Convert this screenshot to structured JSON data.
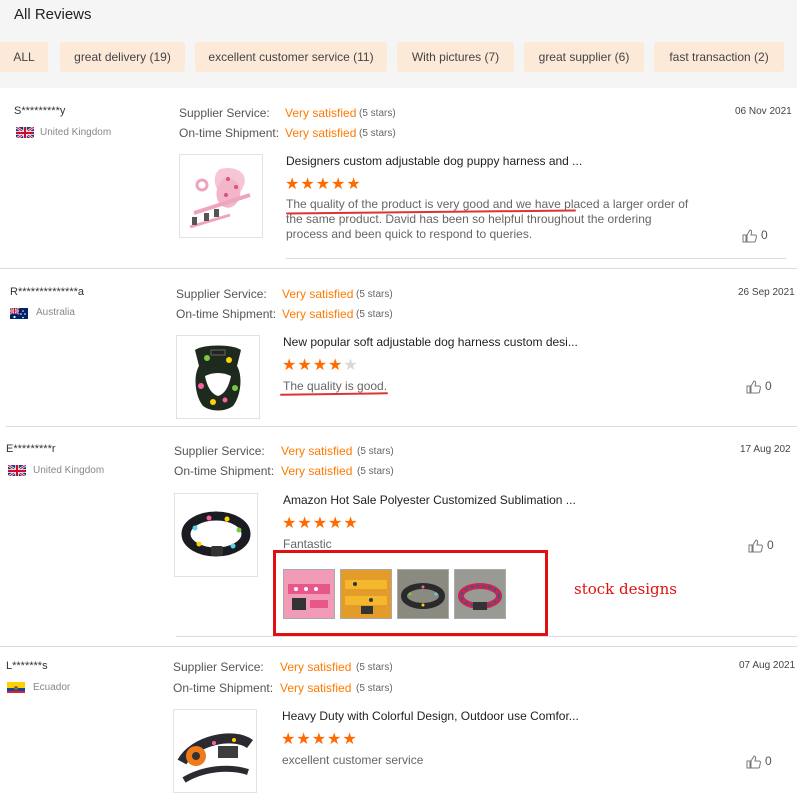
{
  "header": {
    "title": "All Reviews"
  },
  "tags": [
    "ALL",
    "great delivery (19)",
    "excellent customer service (11)",
    "With pictures (7)",
    "great supplier (6)",
    "fast transaction (2)"
  ],
  "labels": {
    "supplier_service": "Supplier Service:",
    "on_time_shipment": "On-time Shipment:"
  },
  "reviews": [
    {
      "user": "S*********y",
      "country": "United Kingdom",
      "date": "06 Nov 2021",
      "supplier_service": "Very satisfied",
      "supplier_stars": "(5 stars)",
      "shipment": "Very satisfied",
      "shipment_stars": "(5 stars)",
      "product": "Designers custom adjustable dog puppy harness and ...",
      "rating": 5,
      "text": "The quality of the product is very good and we have placed a larger order of the same product. David has been so helpful throughout the ordering process and been quick to respond to queries.",
      "likes": "0"
    },
    {
      "user": "R**************a",
      "country": "Australia",
      "date": "26 Sep 2021",
      "supplier_service": "Very satisfied",
      "supplier_stars": "(5 stars)",
      "shipment": "Very satisfied",
      "shipment_stars": "(5 stars)",
      "product": "New popular soft adjustable dog harness custom desi...",
      "rating": 4,
      "text": "The quality is good.",
      "likes": "0"
    },
    {
      "user": "E*********r",
      "country": "United Kingdom",
      "date": "17 Aug 202",
      "supplier_service": "Very satisfied",
      "supplier_stars": "(5 stars)",
      "shipment": "Very satisfied",
      "shipment_stars": "(5 stars)",
      "product": "Amazon Hot Sale Polyester Customized Sublimation ...",
      "rating": 5,
      "text": "Fantastic",
      "likes": "0"
    },
    {
      "user": "L*******s",
      "country": "Ecuador",
      "date": "07 Aug 2021",
      "supplier_service": "Very satisfied",
      "supplier_stars": "(5 stars)",
      "shipment": "Very satisfied",
      "shipment_stars": "(5 stars)",
      "product": "Heavy Duty with Colorful Design, Outdoor use Comfor...",
      "rating": 5,
      "text": "excellent customer service",
      "likes": "0"
    }
  ],
  "annotation": "stock designs",
  "colors": {
    "accent": "#ff6a00",
    "satisfied": "#ff7a00",
    "tag_bg": "#fde9d8",
    "markup_red": "#e01010"
  }
}
